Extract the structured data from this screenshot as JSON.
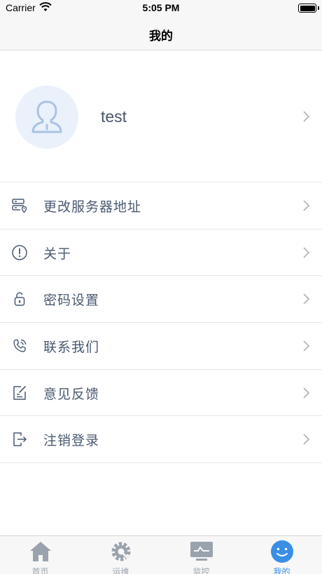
{
  "status_bar": {
    "carrier": "Carrier",
    "time": "5:05 PM"
  },
  "nav": {
    "title": "我的"
  },
  "profile": {
    "username": "test"
  },
  "menu": {
    "items": [
      {
        "label": "更改服务器地址",
        "icon": "server-location-icon"
      },
      {
        "label": "关于",
        "icon": "info-icon"
      },
      {
        "label": "密码设置",
        "icon": "lock-icon"
      },
      {
        "label": "联系我们",
        "icon": "phone-icon"
      },
      {
        "label": "意见反馈",
        "icon": "feedback-edit-icon"
      },
      {
        "label": "注销登录",
        "icon": "logout-icon"
      }
    ]
  },
  "tabs": [
    {
      "label": "首页",
      "icon": "home-icon"
    },
    {
      "label": "运维",
      "icon": "gear-wrench-icon"
    },
    {
      "label": "监控",
      "icon": "monitor-icon"
    },
    {
      "label": "我的",
      "icon": "smiley-icon",
      "active": true
    }
  ],
  "colors": {
    "accent": "#3a8ee6",
    "text": "#4a5a70",
    "inactive": "#9aa3ad",
    "avatar_bg": "#eaf1fb"
  }
}
